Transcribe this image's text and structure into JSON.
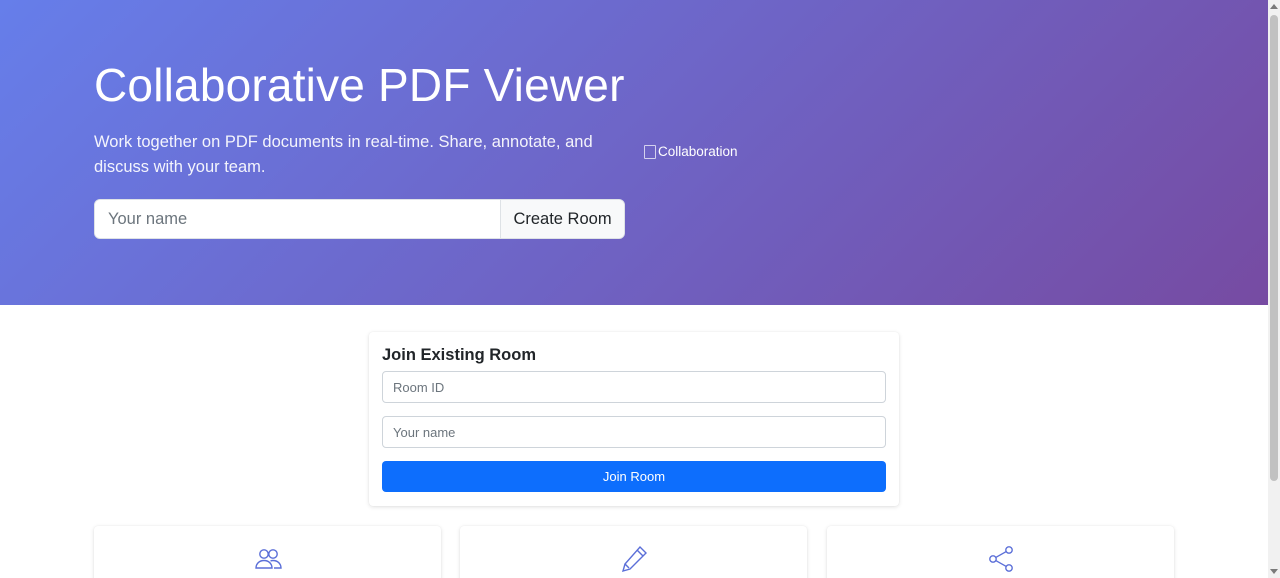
{
  "hero": {
    "title": "Collaborative PDF Viewer",
    "subtitle": "Work together on PDF documents in real-time. Share, annotate, and discuss with your team.",
    "name_placeholder": "Your name",
    "create_label": "Create Room",
    "image_alt": "Collaboration"
  },
  "join": {
    "title": "Join Existing Room",
    "room_placeholder": "Room ID",
    "name_placeholder": "Your name",
    "join_label": "Join Room"
  },
  "features": [
    {
      "icon": "people-icon"
    },
    {
      "icon": "pencil-icon"
    },
    {
      "icon": "share-icon"
    }
  ],
  "colors": {
    "hero_gradient_start": "#667eea",
    "hero_gradient_end": "#764ba2",
    "primary": "#0d6efd",
    "feature_icon": "#5b6fd8"
  }
}
